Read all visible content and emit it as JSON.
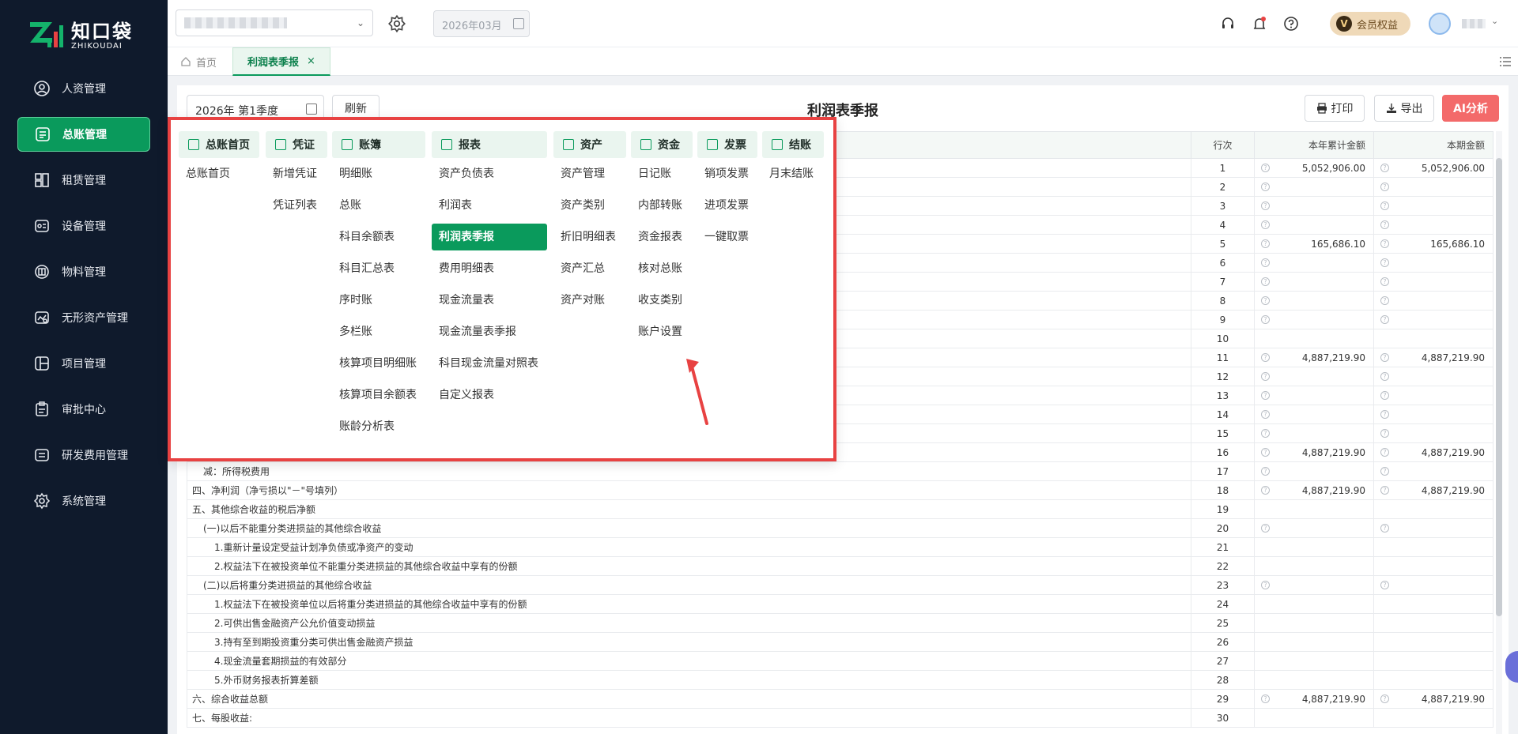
{
  "logo": {
    "title": "知口袋",
    "subtitle": "ZHIKOUDAI"
  },
  "sidebar": {
    "items": [
      {
        "label": "人资管理"
      },
      {
        "label": "总账管理"
      },
      {
        "label": "租赁管理"
      },
      {
        "label": "设备管理"
      },
      {
        "label": "物料管理"
      },
      {
        "label": "无形资产管理"
      },
      {
        "label": "项目管理"
      },
      {
        "label": "审批中心"
      },
      {
        "label": "研发费用管理"
      },
      {
        "label": "系统管理"
      }
    ]
  },
  "header": {
    "period": "2026年03月",
    "vip_label": "会员权益",
    "vip_letter": "V"
  },
  "tabs": {
    "home": "首页",
    "active": "利润表季报",
    "close": "×"
  },
  "toolbar": {
    "quarter": "2026年 第1季度",
    "refresh": "刷新",
    "title": "利润表季报",
    "print": "打印",
    "export": "导出",
    "ai": "AI分析"
  },
  "table": {
    "headers": {
      "rowno": "行次",
      "ytd": "本年累计金额",
      "period": "本期金额"
    },
    "rows": [
      {
        "label": "",
        "no": "1",
        "ytd": "5,052,906.00",
        "cur": "5,052,906.00",
        "q": true
      },
      {
        "label": "",
        "no": "2",
        "ytd": "",
        "cur": "",
        "q": true
      },
      {
        "label": "",
        "no": "3",
        "ytd": "",
        "cur": "",
        "q": true
      },
      {
        "label": "",
        "no": "4",
        "ytd": "",
        "cur": "",
        "q": true
      },
      {
        "label": "",
        "no": "5",
        "ytd": "165,686.10",
        "cur": "165,686.10",
        "q": true
      },
      {
        "label": "",
        "no": "6",
        "ytd": "",
        "cur": "",
        "q": true
      },
      {
        "label": "",
        "no": "7",
        "ytd": "",
        "cur": "",
        "q": true
      },
      {
        "label": "",
        "no": "8",
        "ytd": "",
        "cur": "",
        "q": true
      },
      {
        "label": "",
        "no": "9",
        "ytd": "",
        "cur": "",
        "q": true
      },
      {
        "label": "",
        "no": "10",
        "ytd": "",
        "cur": "",
        "q": false
      },
      {
        "label": "",
        "no": "11",
        "ytd": "4,887,219.90",
        "cur": "4,887,219.90",
        "q": true
      },
      {
        "label": "",
        "no": "12",
        "ytd": "",
        "cur": "",
        "q": true
      },
      {
        "label": "",
        "no": "13",
        "ytd": "",
        "cur": "",
        "q": true
      },
      {
        "label": "",
        "no": "14",
        "ytd": "",
        "cur": "",
        "q": true
      },
      {
        "label": "",
        "no": "15",
        "ytd": "",
        "cur": "",
        "q": true
      },
      {
        "label": "",
        "no": "16",
        "ytd": "4,887,219.90",
        "cur": "4,887,219.90",
        "q": true
      },
      {
        "label": "减：所得税费用",
        "no": "17",
        "ytd": "",
        "cur": "",
        "q": true,
        "indent": 1
      },
      {
        "label": "四、净利润（净亏损以\"－\"号填列）",
        "no": "18",
        "ytd": "4,887,219.90",
        "cur": "4,887,219.90",
        "q": true
      },
      {
        "label": "五、其他综合收益的税后净额",
        "no": "19",
        "ytd": "",
        "cur": "",
        "q": false
      },
      {
        "label": "(一)以后不能重分类进损益的其他综合收益",
        "no": "20",
        "ytd": "",
        "cur": "",
        "q": true,
        "indent": 1
      },
      {
        "label": "1.重新计量设定受益计划净负债或净资产的变动",
        "no": "21",
        "ytd": "",
        "cur": "",
        "q": false,
        "indent": 2
      },
      {
        "label": "2.权益法下在被投资单位不能重分类进损益的其他综合收益中享有的份额",
        "no": "22",
        "ytd": "",
        "cur": "",
        "q": false,
        "indent": 2
      },
      {
        "label": "(二)以后将重分类进损益的其他综合收益",
        "no": "23",
        "ytd": "",
        "cur": "",
        "q": true,
        "indent": 1
      },
      {
        "label": "1.权益法下在被投资单位以后将重分类进损益的其他综合收益中享有的份额",
        "no": "24",
        "ytd": "",
        "cur": "",
        "q": false,
        "indent": 2
      },
      {
        "label": "2.可供出售金融资产公允价值变动损益",
        "no": "25",
        "ytd": "",
        "cur": "",
        "q": false,
        "indent": 2
      },
      {
        "label": "3.持有至到期投资重分类可供出售金融资产损益",
        "no": "26",
        "ytd": "",
        "cur": "",
        "q": false,
        "indent": 2
      },
      {
        "label": "4.现金流量套期损益的有效部分",
        "no": "27",
        "ytd": "",
        "cur": "",
        "q": false,
        "indent": 2
      },
      {
        "label": "5.外币财务报表折算差额",
        "no": "28",
        "ytd": "",
        "cur": "",
        "q": false,
        "indent": 2
      },
      {
        "label": "六、综合收益总额",
        "no": "29",
        "ytd": "4,887,219.90",
        "cur": "4,887,219.90",
        "q": true
      },
      {
        "label": "七、每股收益:",
        "no": "30",
        "ytd": "",
        "cur": "",
        "q": false
      }
    ]
  },
  "menu": {
    "columns": [
      {
        "head": "总账首页",
        "items": [
          "总账首页"
        ]
      },
      {
        "head": "凭证",
        "items": [
          "新增凭证",
          "凭证列表"
        ]
      },
      {
        "head": "账簿",
        "items": [
          "明细账",
          "总账",
          "科目余额表",
          "科目汇总表",
          "序时账",
          "多栏账",
          "核算项目明细账",
          "核算项目余额表",
          "账龄分析表"
        ]
      },
      {
        "head": "报表",
        "items": [
          "资产负债表",
          "利润表",
          "利润表季报",
          "费用明细表",
          "现金流量表",
          "现金流量表季报",
          "科目现金流量对照表",
          "自定义报表"
        ],
        "selected": 2
      },
      {
        "head": "资产",
        "items": [
          "资产管理",
          "资产类别",
          "折旧明细表",
          "资产汇总",
          "资产对账"
        ]
      },
      {
        "head": "资金",
        "items": [
          "日记账",
          "内部转账",
          "资金报表",
          "核对总账",
          "收支类别",
          "账户设置"
        ]
      },
      {
        "head": "发票",
        "items": [
          "销项发票",
          "进项发票",
          "一键取票"
        ]
      },
      {
        "head": "结账",
        "items": [
          "月末结账"
        ]
      }
    ]
  },
  "colors": {
    "brand": "#0a9a5c",
    "highlight_border": "#e84242",
    "ai_button": "#f36a6a"
  }
}
